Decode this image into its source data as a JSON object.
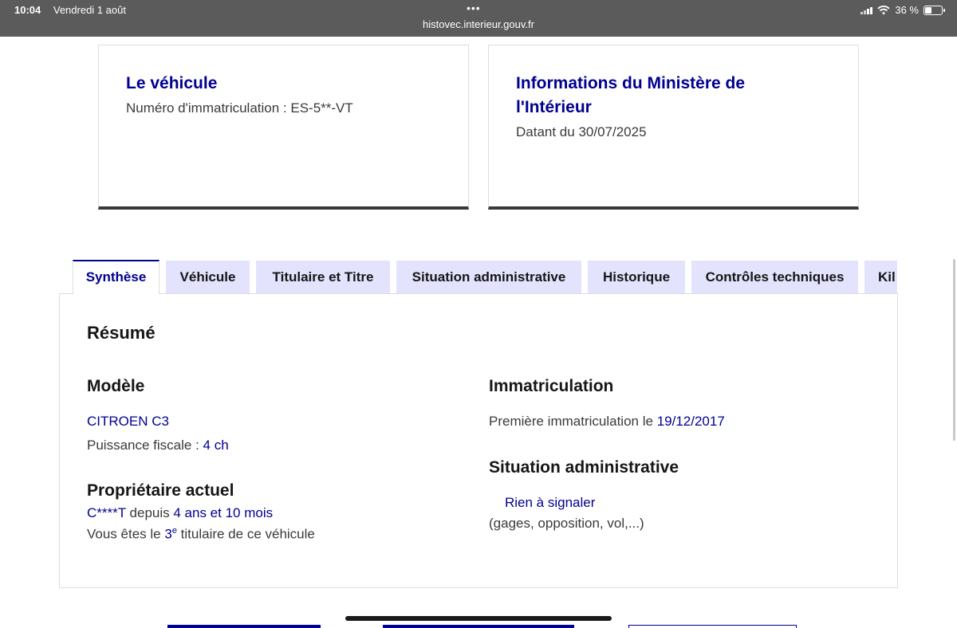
{
  "status_bar": {
    "time": "10:04",
    "date": "Vendredi 1 août",
    "dots": "•••",
    "url": "histovec.interieur.gouv.fr",
    "battery": "36 %"
  },
  "cards": {
    "vehicle": {
      "title": "Le véhicule",
      "text": "Numéro d'immatriculation : ES-5**-VT"
    },
    "ministry": {
      "title": "Informations du Ministère de l'Intérieur",
      "text": "Datant du 30/07/2025"
    }
  },
  "tabs": [
    {
      "label": "Synthèse",
      "active": true
    },
    {
      "label": "Véhicule",
      "active": false
    },
    {
      "label": "Titulaire et Titre",
      "active": false
    },
    {
      "label": "Situation administrative",
      "active": false
    },
    {
      "label": "Historique",
      "active": false
    },
    {
      "label": "Contrôles techniques",
      "active": false
    },
    {
      "label": "Kil",
      "active": false
    }
  ],
  "summary": {
    "title": "Résumé",
    "model": {
      "title": "Modèle",
      "name": "CITROEN C3",
      "power_label": "Puissance fiscale : ",
      "power_value": "4 ch"
    },
    "owner": {
      "title": "Propriétaire actuel",
      "name": "C****T",
      "since_label": " depuis ",
      "since_value": "4 ans et 10 mois",
      "rank_prefix": "Vous êtes le ",
      "rank_value": "3",
      "rank_sup": "e",
      "rank_suffix": " titulaire de ce véhicule"
    },
    "registration": {
      "title": "Immatriculation",
      "first_label": "Première immatriculation le ",
      "first_date": "19/12/2017"
    },
    "admin": {
      "title": "Situation administrative",
      "status": "Rien à signaler",
      "details": "(gages, opposition, vol,...)"
    }
  },
  "colors": {
    "accent": "#000091",
    "tab_bg": "#e3e3fd",
    "topbar": "#5b5b5b"
  }
}
